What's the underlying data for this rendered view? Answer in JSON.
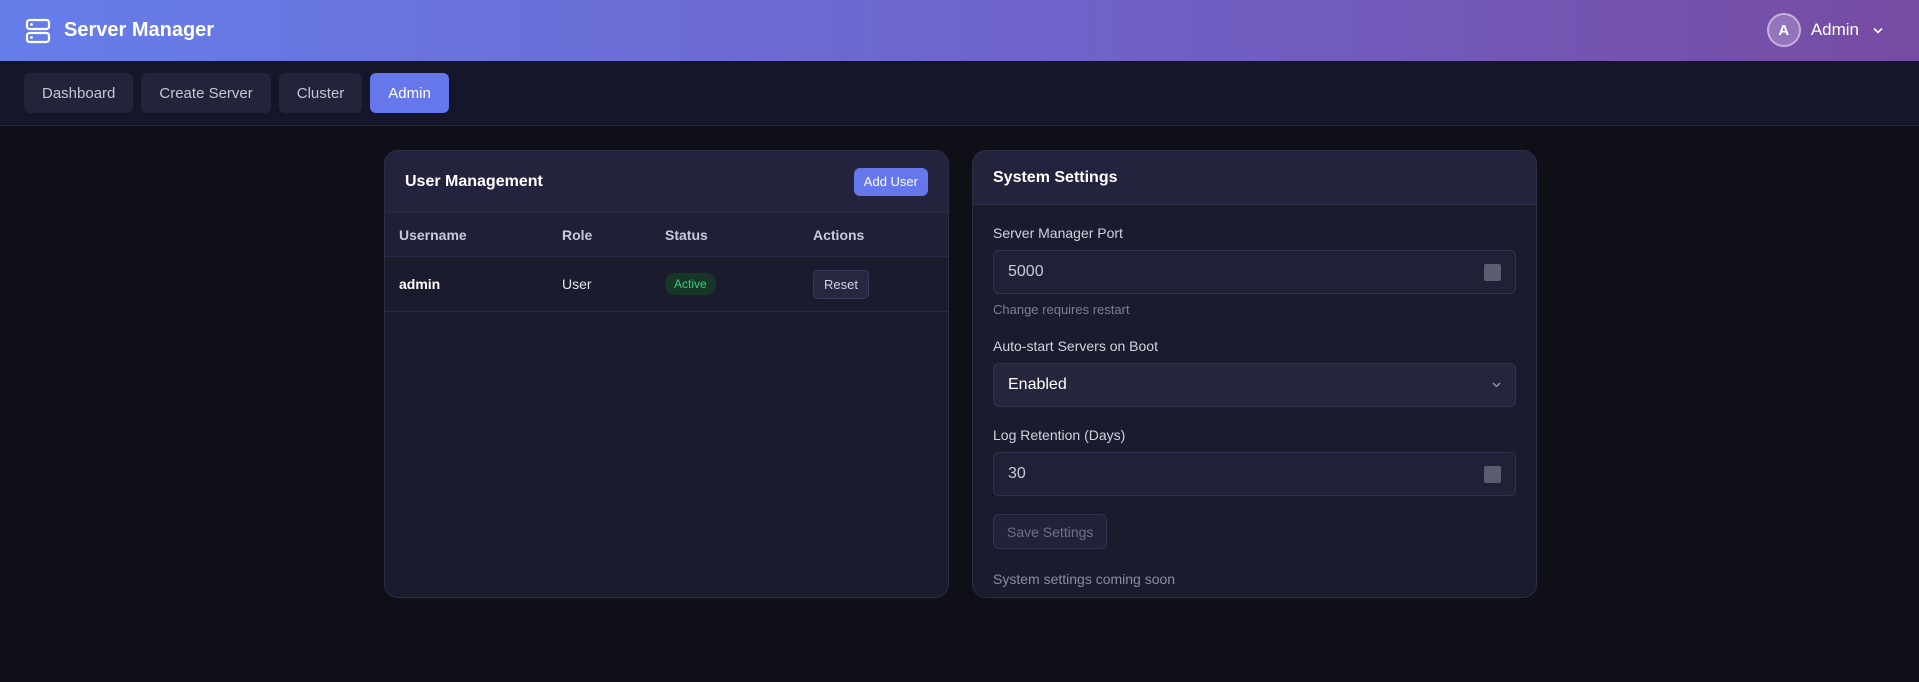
{
  "app": {
    "title": "Server Manager"
  },
  "user": {
    "initial": "A",
    "name": "Admin"
  },
  "nav": {
    "tabs": [
      {
        "label": "Dashboard",
        "active": false
      },
      {
        "label": "Create Server",
        "active": false
      },
      {
        "label": "Cluster",
        "active": false
      },
      {
        "label": "Admin",
        "active": true
      }
    ]
  },
  "users_panel": {
    "title": "User Management",
    "add_button": "Add User",
    "columns": [
      "Username",
      "Role",
      "Status",
      "Actions"
    ],
    "rows": [
      {
        "username": "admin",
        "role": "User",
        "status": "Active",
        "action": "Reset"
      }
    ]
  },
  "settings_panel": {
    "title": "System Settings",
    "port": {
      "label": "Server Manager Port",
      "value": "5000",
      "help": "Change requires restart"
    },
    "autostart": {
      "label": "Auto-start Servers on Boot",
      "value": "Enabled"
    },
    "retention": {
      "label": "Log Retention (Days)",
      "value": "30"
    },
    "save_button": "Save Settings",
    "note": "System settings coming soon"
  },
  "colors": {
    "accent": "#6577ea",
    "header_gradient_start": "#667eea",
    "header_gradient_end": "#764ba2",
    "status_active": "#34d17a"
  },
  "icons": {
    "logo": "server-icon",
    "user_menu": "chevron-down-icon",
    "select": "chevron-down-icon"
  }
}
